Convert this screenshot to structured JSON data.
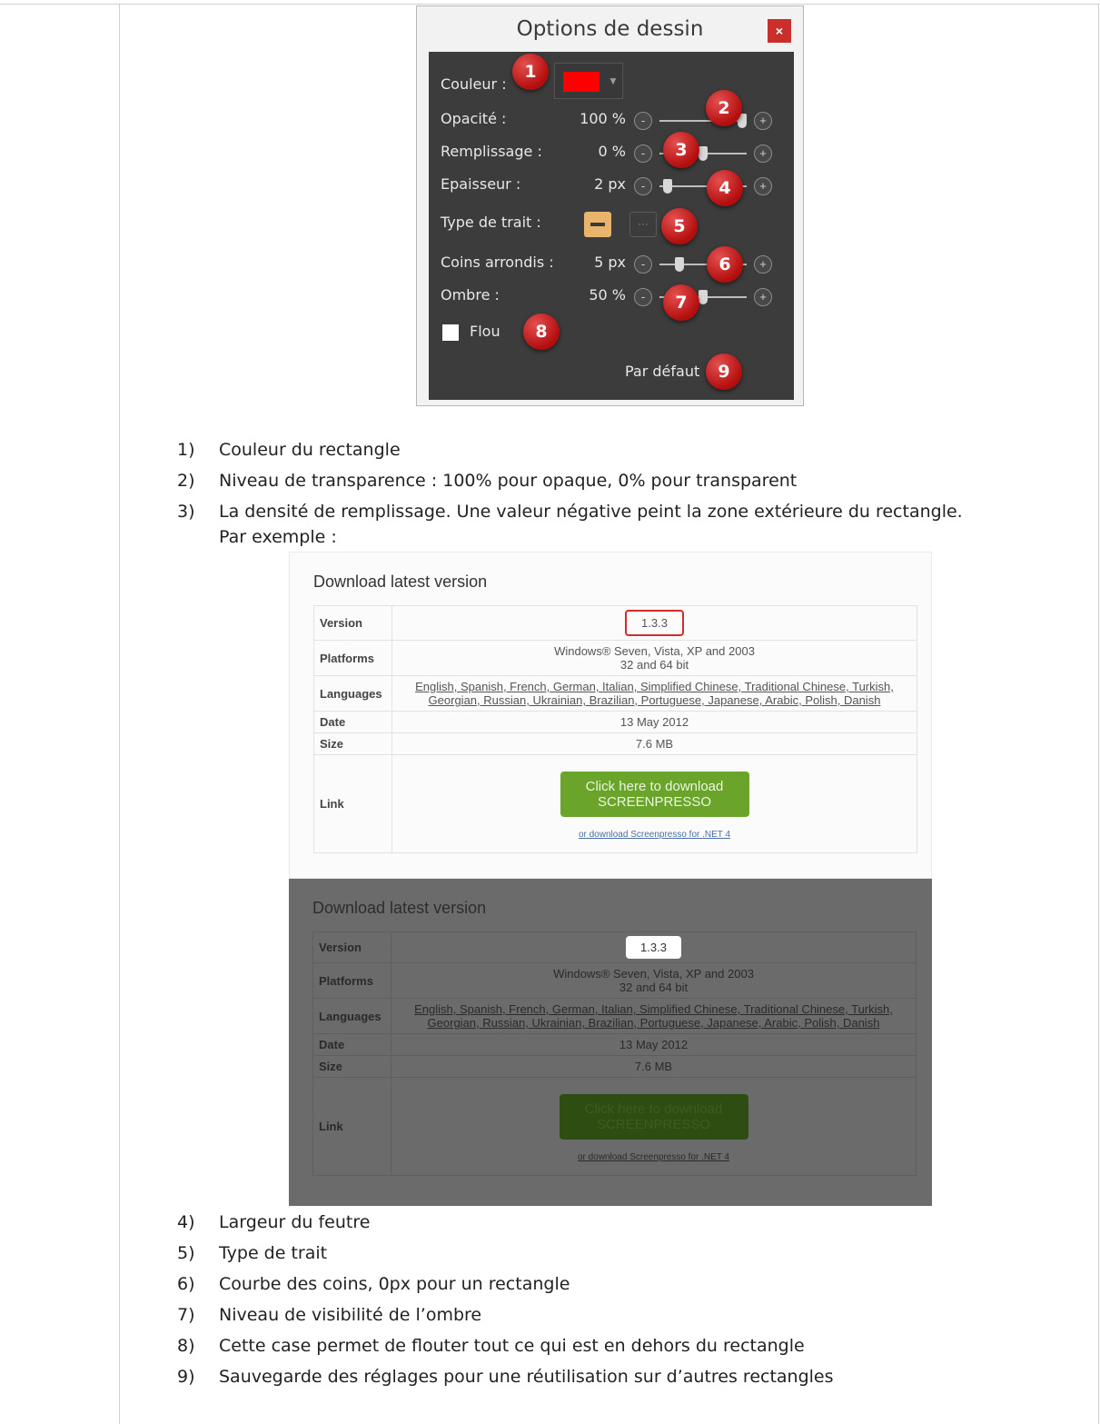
{
  "dialog": {
    "title": "Options de dessin",
    "close": "×",
    "color_label": "Couleur :",
    "color_value": "#ff0000",
    "rows": [
      {
        "label": "Opacité :",
        "value": "100 %"
      },
      {
        "label": "Remplissage :",
        "value": "0 %"
      },
      {
        "label": "Epaisseur :",
        "value": "2 px"
      },
      {
        "label": "Type de trait :"
      },
      {
        "label": "Coins arrondis :",
        "value": "5 px"
      },
      {
        "label": "Ombre :",
        "value": "50 %"
      }
    ],
    "slider_levels": {
      "opacity": 1.0,
      "fill": 0.5,
      "thickness": 0.05,
      "corners": 0.2,
      "shadow": 0.5
    },
    "minus": "-",
    "plus": "+",
    "dashed": "···",
    "blur_label": "Flou",
    "default_label": "Par défaut",
    "badges": [
      "1",
      "2",
      "3",
      "4",
      "5",
      "6",
      "7",
      "8",
      "9"
    ]
  },
  "list": {
    "items": [
      {
        "num": "1)",
        "text": "Couleur du rectangle"
      },
      {
        "num": "2)",
        "text": "Niveau de transparence : 100% pour opaque, 0% pour transparent"
      },
      {
        "num": "3)",
        "text": "La densité de remplissage. Une valeur négative peint la zone extérieure du rectangle."
      },
      {
        "num": "4)",
        "text": "Largeur du feutre"
      },
      {
        "num": "5)",
        "text": "Type de trait"
      },
      {
        "num": "6)",
        "text": "Courbe des coins, 0px pour un rectangle"
      },
      {
        "num": "7)",
        "text": "Niveau de visibilité de l’ombre"
      },
      {
        "num": "8)",
        "text": "Cette case permet de flouter tout ce qui est en dehors du rectangle"
      },
      {
        "num": "9)",
        "text": "Sauvegarde des réglages pour une réutilisation sur d’autres rectangles"
      }
    ],
    "continuation": "Par exemple :"
  },
  "download": {
    "title": "Download latest version",
    "version_label": "Version",
    "version_value": "1.3.3",
    "platforms_label": "Platforms",
    "platforms_line1": "Windows® Seven, Vista, XP and 2003",
    "platforms_line2": "32 and 64 bit",
    "languages_label": "Languages",
    "languages_line1": "English, Spanish, French, German, Italian, Simplified Chinese, Traditional Chinese, Turkish,",
    "languages_line2": "Georgian, Russian, Ukrainian, Brazilian, Portuguese, Japanese, Arabic, Polish, Danish",
    "date_label": "Date",
    "date_value": "13 May 2012",
    "size_label": "Size",
    "size_value": "7.6 MB",
    "link_label": "Link",
    "button_line1": "Click here to download",
    "button_line2": "SCREENPRESSO",
    "alt_link": "or download Screenpresso for .NET 4"
  }
}
